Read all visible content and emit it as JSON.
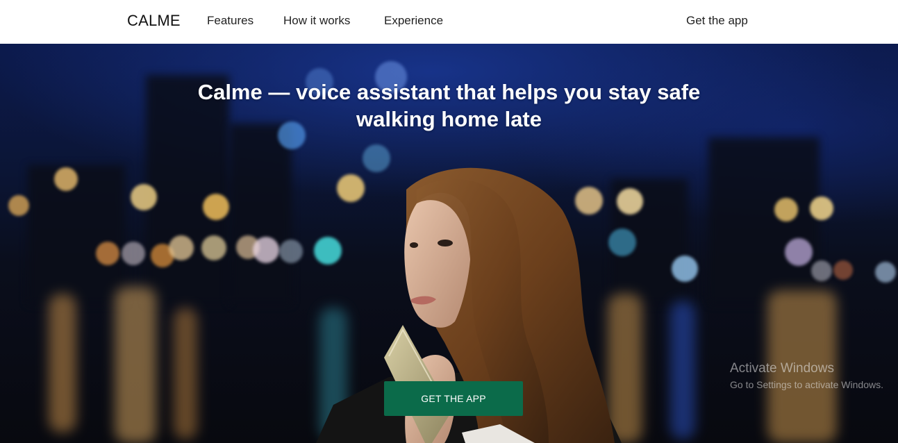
{
  "header": {
    "brand": "CALME",
    "nav": {
      "features": "Features",
      "how_it_works": "How it works",
      "experience": "Experience"
    },
    "get_app": "Get the app"
  },
  "hero": {
    "headline_line1": "Calme — voice assistant that helps you stay safe",
    "headline_line2": "walking home late",
    "cta_label": "GET THE APP",
    "cta_color": "#0b6b4a"
  },
  "watermark": {
    "title": "Activate Windows",
    "subtitle": "Go to Settings to activate Windows."
  }
}
